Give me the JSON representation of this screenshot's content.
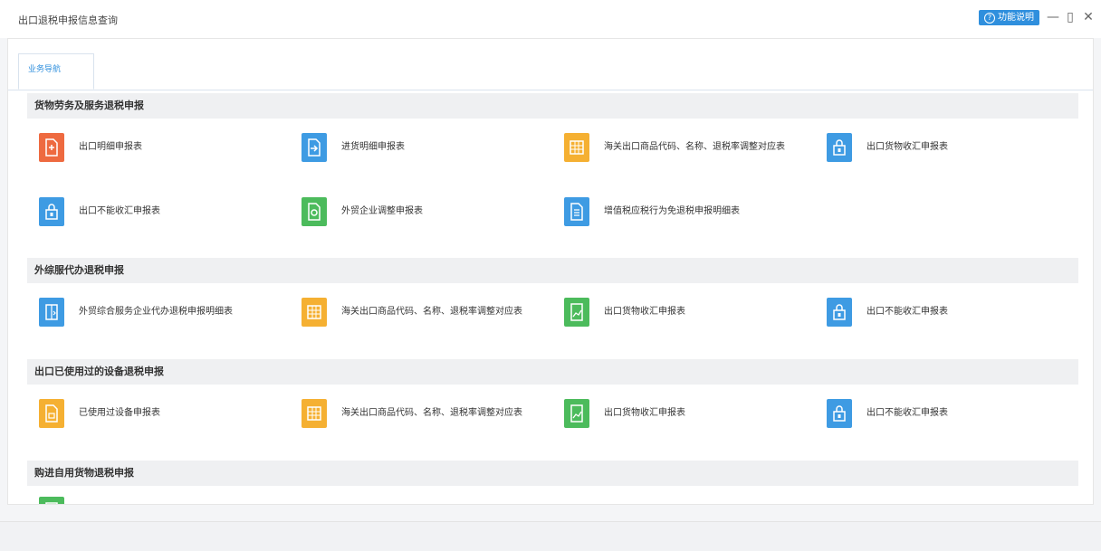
{
  "window": {
    "title": "出口退税申报信息查询",
    "help_label": "功能说明",
    "minimize": "—",
    "restore": "▯",
    "close": "✕"
  },
  "tabs": [
    {
      "label": "业务导航"
    }
  ],
  "sections": [
    {
      "title": "货物劳务及服务退税申报",
      "items": [
        {
          "label": "出口明细申报表",
          "icon": "export-doc-icon",
          "color": "#ee6a40"
        },
        {
          "label": "进货明细申报表",
          "icon": "import-doc-icon",
          "color": "#3e9be3"
        },
        {
          "label": "海关出口商品代码、名称、退税率调整对应表",
          "icon": "table-icon",
          "color": "#f5b032"
        },
        {
          "label": "出口货物收汇申报表",
          "icon": "lock-doc-icon",
          "color": "#3e9be3"
        },
        {
          "label": "出口不能收汇申报表",
          "icon": "lock-doc-icon",
          "color": "#3e9be3"
        },
        {
          "label": "外贸企业调整申报表",
          "icon": "edit-doc-icon",
          "color": "#4cbb5c"
        },
        {
          "label": "增值税应税行为免退税申报明细表",
          "icon": "list-doc-icon",
          "color": "#3e9be3"
        }
      ]
    },
    {
      "title": "外综服代办退税申报",
      "items": [
        {
          "label": "外贸综合服务企业代办退税申报明细表",
          "icon": "export-doc-icon",
          "color": "#3e9be3"
        },
        {
          "label": "海关出口商品代码、名称、退税率调整对应表",
          "icon": "table-icon",
          "color": "#f5b032"
        },
        {
          "label": "出口货物收汇申报表",
          "icon": "chart-doc-icon",
          "color": "#4cbb5c"
        },
        {
          "label": "出口不能收汇申报表",
          "icon": "lock-doc-icon",
          "color": "#3e9be3"
        }
      ]
    },
    {
      "title": "出口已使用过的设备退税申报",
      "items": [
        {
          "label": "已使用过设备申报表",
          "icon": "device-doc-icon",
          "color": "#f5b032"
        },
        {
          "label": "海关出口商品代码、名称、退税率调整对应表",
          "icon": "table-icon",
          "color": "#f5b032"
        },
        {
          "label": "出口货物收汇申报表",
          "icon": "chart-doc-icon",
          "color": "#4cbb5c"
        },
        {
          "label": "出口不能收汇申报表",
          "icon": "lock-doc-icon",
          "color": "#3e9be3"
        }
      ]
    },
    {
      "title": "购进自用货物退税申报",
      "items": [
        {
          "label": "",
          "icon": "doc-icon",
          "color": "#4cbb5c"
        }
      ]
    }
  ]
}
